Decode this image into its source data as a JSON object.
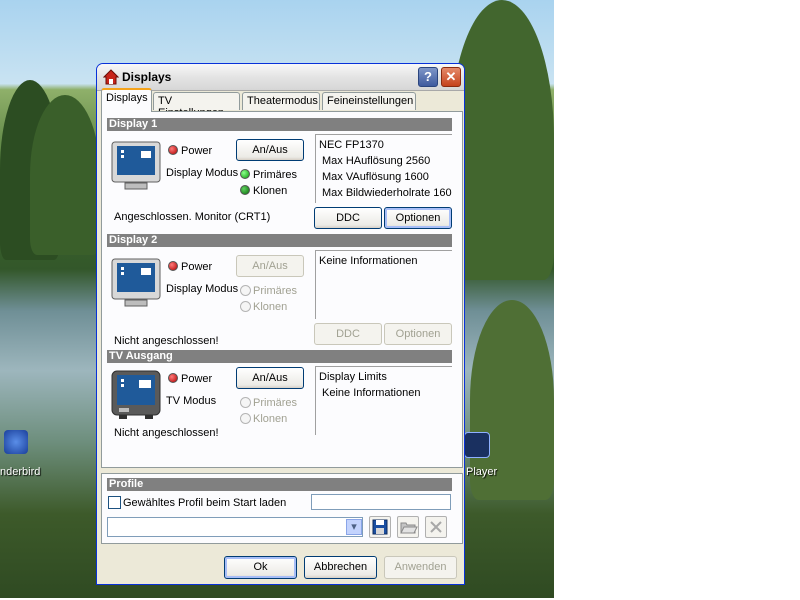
{
  "desktop": {
    "icons": [
      {
        "label": "nderbird"
      },
      {
        "label": "Player"
      }
    ]
  },
  "window": {
    "title": "Displays",
    "help_glyph": "?",
    "close_glyph": "✕"
  },
  "tabs": [
    {
      "label": "Displays",
      "active": true
    },
    {
      "label": "TV Einstellungen"
    },
    {
      "label": "Theatermodus"
    },
    {
      "label": "Feineinstellungen"
    }
  ],
  "display1": {
    "header": "Display 1",
    "power_label": "Power",
    "onoff_label": "An/Aus",
    "mode_label": "Display Modus",
    "primary_label": "Primäres",
    "clone_label": "Klonen",
    "status": "Angeschlossen. Monitor (CRT1)",
    "ddc_label": "DDC",
    "options_label": "Optionen",
    "info": [
      "NEC FP1370",
      "Max HAuflösung 2560",
      "Max VAuflösung 1600",
      "Max Bildwiederholrate 160"
    ]
  },
  "display2": {
    "header": "Display 2",
    "power_label": "Power",
    "onoff_label": "An/Aus",
    "mode_label": "Display Modus",
    "primary_label": "Primäres",
    "clone_label": "Klonen",
    "status": "Nicht angeschlossen!",
    "ddc_label": "DDC",
    "options_label": "Optionen",
    "info": [
      "Keine Informationen"
    ]
  },
  "tv": {
    "header": "TV Ausgang",
    "power_label": "Power",
    "onoff_label": "An/Aus",
    "mode_label": "TV Modus",
    "primary_label": "Primäres",
    "clone_label": "Klonen",
    "status": "Nicht angeschlossen!",
    "info": [
      "Display Limits",
      "Keine Informationen"
    ]
  },
  "profile": {
    "header": "Profile",
    "checkbox_label": "Gewähltes Profil beim Start laden",
    "dropdown_glyph": "▾"
  },
  "footer": {
    "ok_label": "Ok",
    "cancel_label": "Abbrechen",
    "apply_label": "Anwenden"
  },
  "colors": {
    "section_header": "#808080",
    "led_red": "#b00000",
    "led_green": "#0a9a0a",
    "title_border": "#0831d9"
  }
}
